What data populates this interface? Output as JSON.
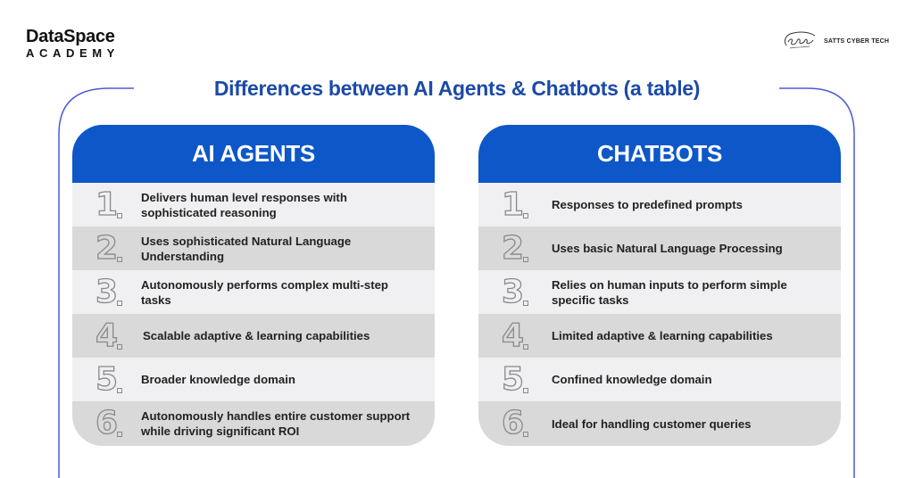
{
  "logos": {
    "left": {
      "brand": "DataSpace",
      "sub": "ACADEMY"
    },
    "right": {
      "name": "SATTS CYBER TECH",
      "mark_icon": "satts-signature-logo"
    }
  },
  "title": "Differences between AI Agents & Chatbots (a table)",
  "colors": {
    "header_blue": "#0d57c8",
    "title_blue": "#1b4aa8",
    "frame_line": "#4b5bd0",
    "row_light": "#f0f0f2",
    "row_dark": "#d9d9d9"
  },
  "columns": [
    {
      "header": "AI AGENTS",
      "rows": [
        {
          "num": "1",
          "text": "Delivers human level responses with sophisticated reasoning"
        },
        {
          "num": "2",
          "text": "Uses sophisticated Natural Language Understanding"
        },
        {
          "num": "3",
          "text": "Autonomously performs complex multi-step tasks"
        },
        {
          "num": "4",
          "text": "Scalable  adaptive & learning capabilities"
        },
        {
          "num": "5",
          "text": "Broader knowledge domain"
        },
        {
          "num": "6",
          "text": "Autonomously handles entire customer support while driving significant ROI"
        }
      ]
    },
    {
      "header": "CHATBOTS",
      "rows": [
        {
          "num": "1",
          "text": "Responses to predefined prompts"
        },
        {
          "num": "2",
          "text": "Uses basic Natural Language Processing"
        },
        {
          "num": "3",
          "text": "Relies on human inputs to perform simple specific tasks"
        },
        {
          "num": "4",
          "text": "Limited adaptive & learning capabilities"
        },
        {
          "num": "5",
          "text": "Confined knowledge domain"
        },
        {
          "num": "6",
          "text": "Ideal for handling customer queries"
        }
      ]
    }
  ]
}
